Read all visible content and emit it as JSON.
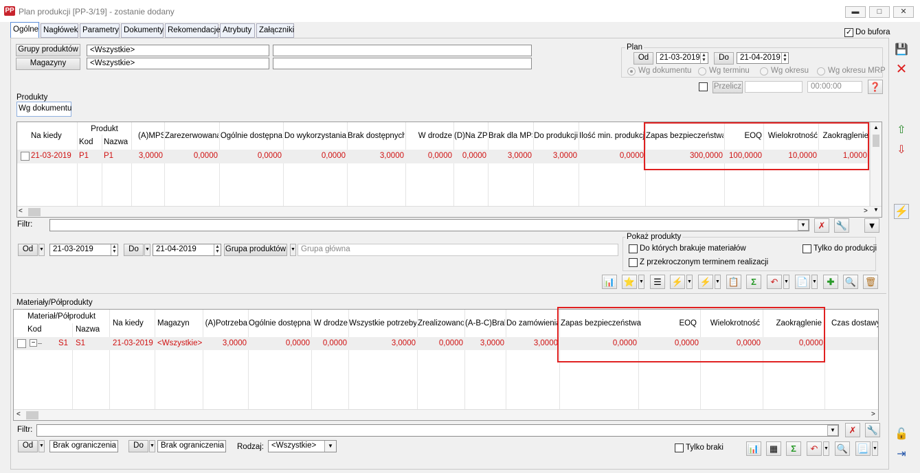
{
  "window": {
    "title": "Plan produkcji [PP-3/19] - zostanie dodany",
    "app_badge": "PP",
    "min_icon": "minimize-icon",
    "max_icon": "maximize-icon",
    "close_icon": "close-icon"
  },
  "tabs": [
    "Ogólne",
    "Nagłówek",
    "Parametry",
    "Dokumenty",
    "Rekomendacje",
    "Atrybuty",
    "Załączniki"
  ],
  "do_bufora": "Do bufora",
  "filters": {
    "grupy_label": "Grupy produktów",
    "grupy_value": "<Wszystkie>",
    "magazyny_label": "Magazyny",
    "magazyny_value": "<Wszystkie>"
  },
  "plan": {
    "legend": "Plan",
    "od_label": "Od",
    "od_value": "21-03-2019",
    "do_label": "Do",
    "do_value": "21-04-2019",
    "radios": [
      "Wg dokumentu",
      "Wg terminu",
      "Wg okresu",
      "Wg okresu MRP"
    ],
    "przelicz": "Przelicz",
    "time": "00:00:00"
  },
  "produkty": {
    "label": "Produkty",
    "subtab": "Wg dokumentu",
    "group_header": "Produkt",
    "headers": [
      "Na kiedy",
      "Kod",
      "Nazwa",
      "(A)MPS",
      "Zarezerwowana",
      "Ogólnie dostępna",
      "Do wykorzystania",
      "Brak dostępnych",
      "W drodze",
      "(D)Na ZP",
      "Brak dla MPS",
      "Do produkcji",
      "Ilość min. produkcji",
      "Zapas bezpieczeństwa",
      "EOQ",
      "Wielokrotność",
      "Zaokrąglenie"
    ],
    "rows": [
      [
        "21-03-2019",
        "P1",
        "P1",
        "3,0000",
        "0,0000",
        "0,0000",
        "0,0000",
        "3,0000",
        "0,0000",
        "0,0000",
        "3,0000",
        "3,0000",
        "0,0000",
        "300,0000",
        "100,0000",
        "10,0000",
        "1,0000"
      ]
    ],
    "filtr_label": "Filtr:",
    "od_label": "Od",
    "od_value": "21-03-2019",
    "do_label": "Do",
    "do_value": "21-04-2019",
    "grupa_label": "Grupa produktów",
    "grupa_value": "Grupa główna",
    "pokaz_legend": "Pokaż produkty",
    "pokaz_opts": [
      "Do których brakuje materiałów",
      "Z przekroczonym terminem realizacji",
      "Tylko do produkcji"
    ]
  },
  "materialy": {
    "label": "Materiały/Półprodukty",
    "group_header": "Materiał/Półprodukt",
    "headers": [
      "Kod",
      "Nazwa",
      "Na kiedy",
      "Magazyn",
      "(A)Potrzeba",
      "Ogólnie dostępna",
      "W drodze",
      "Wszystkie potrzeby",
      "Zrealizowano",
      "(A-B-C)Brak",
      "Do zamówienia",
      "Zapas bezpieczeństwa",
      "EOQ",
      "Wielokrotność",
      "Zaokrąglenie",
      "Czas dostawy"
    ],
    "rows": [
      [
        "S1",
        "S1",
        "21-03-2019",
        "<Wszystkie>",
        "3,0000",
        "0,0000",
        "0,0000",
        "3,0000",
        "0,0000",
        "3,0000",
        "3,0000",
        "0,0000",
        "0,0000",
        "0,0000",
        "0,0000",
        ""
      ]
    ],
    "filtr_label": "Filtr:",
    "od_label": "Od",
    "od_value": "Brak ograniczenia",
    "do_label": "Do",
    "do_value": "Brak ograniczenia",
    "rodzaj_label": "Rodzaj:",
    "rodzaj_value": "<Wszystkie>",
    "tylko_braki": "Tylko braki"
  },
  "colors": {
    "accent_red": "#e02020",
    "data_red": "#d01010",
    "tab_active": "#5b8dd9"
  }
}
